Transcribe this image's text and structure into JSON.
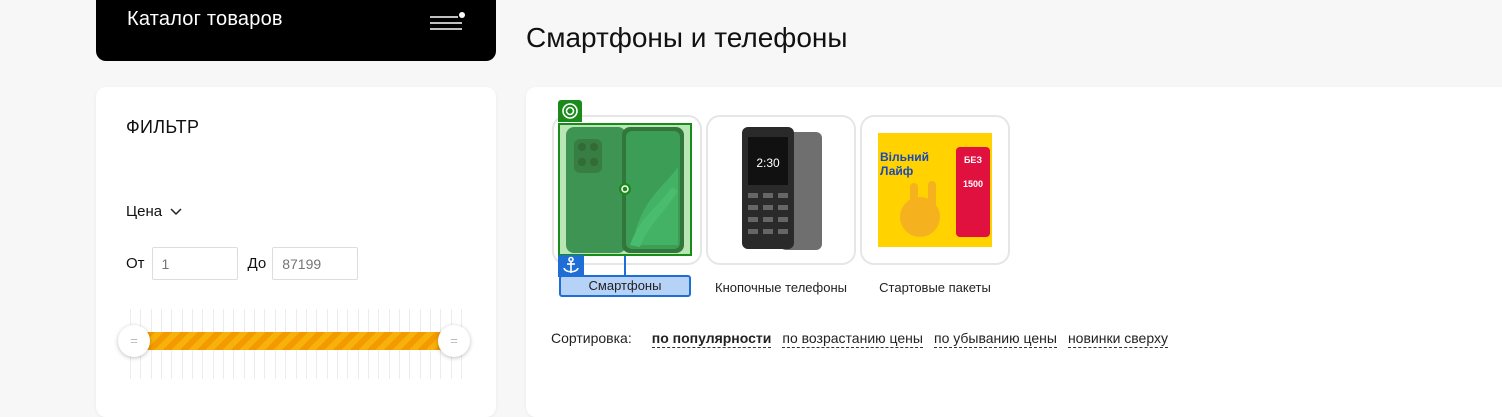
{
  "catalog": {
    "title": "Каталог товаров",
    "menu_icon": "menu-lines-icon"
  },
  "page": {
    "title": "Смартфоны и телефоны"
  },
  "filter": {
    "title": "ФИЛЬТР",
    "price": {
      "label": "Цена",
      "from_label": "От",
      "to_label": "До",
      "from_placeholder": "1",
      "to_placeholder": "87199",
      "range_min_fraction": 0,
      "range_max_fraction": 1
    }
  },
  "categories": [
    {
      "label": "Смартфоны",
      "icon": "smartphone-image",
      "selected": true
    },
    {
      "label": "Кнопочные телефоны",
      "icon": "button-phone-image"
    },
    {
      "label": "Стартовые пакеты",
      "icon": "sim-starter-pack-image",
      "promo_text_1": "Вільний",
      "promo_text_2": "Лайф",
      "promo_badge_1": "БЕЗ",
      "promo_badge_2": "1500"
    }
  ],
  "phone_screen_time": "2:30",
  "sort": {
    "label": "Сортировка:",
    "options": [
      "по популярности",
      "по возрастанию цены",
      "по убыванию цены",
      "новинки сверху"
    ],
    "active": "по популярности"
  },
  "colors": {
    "accent_orange": "#f39a00",
    "selection_green": "#1a8a1a",
    "selection_blue": "#1e6ed6"
  }
}
